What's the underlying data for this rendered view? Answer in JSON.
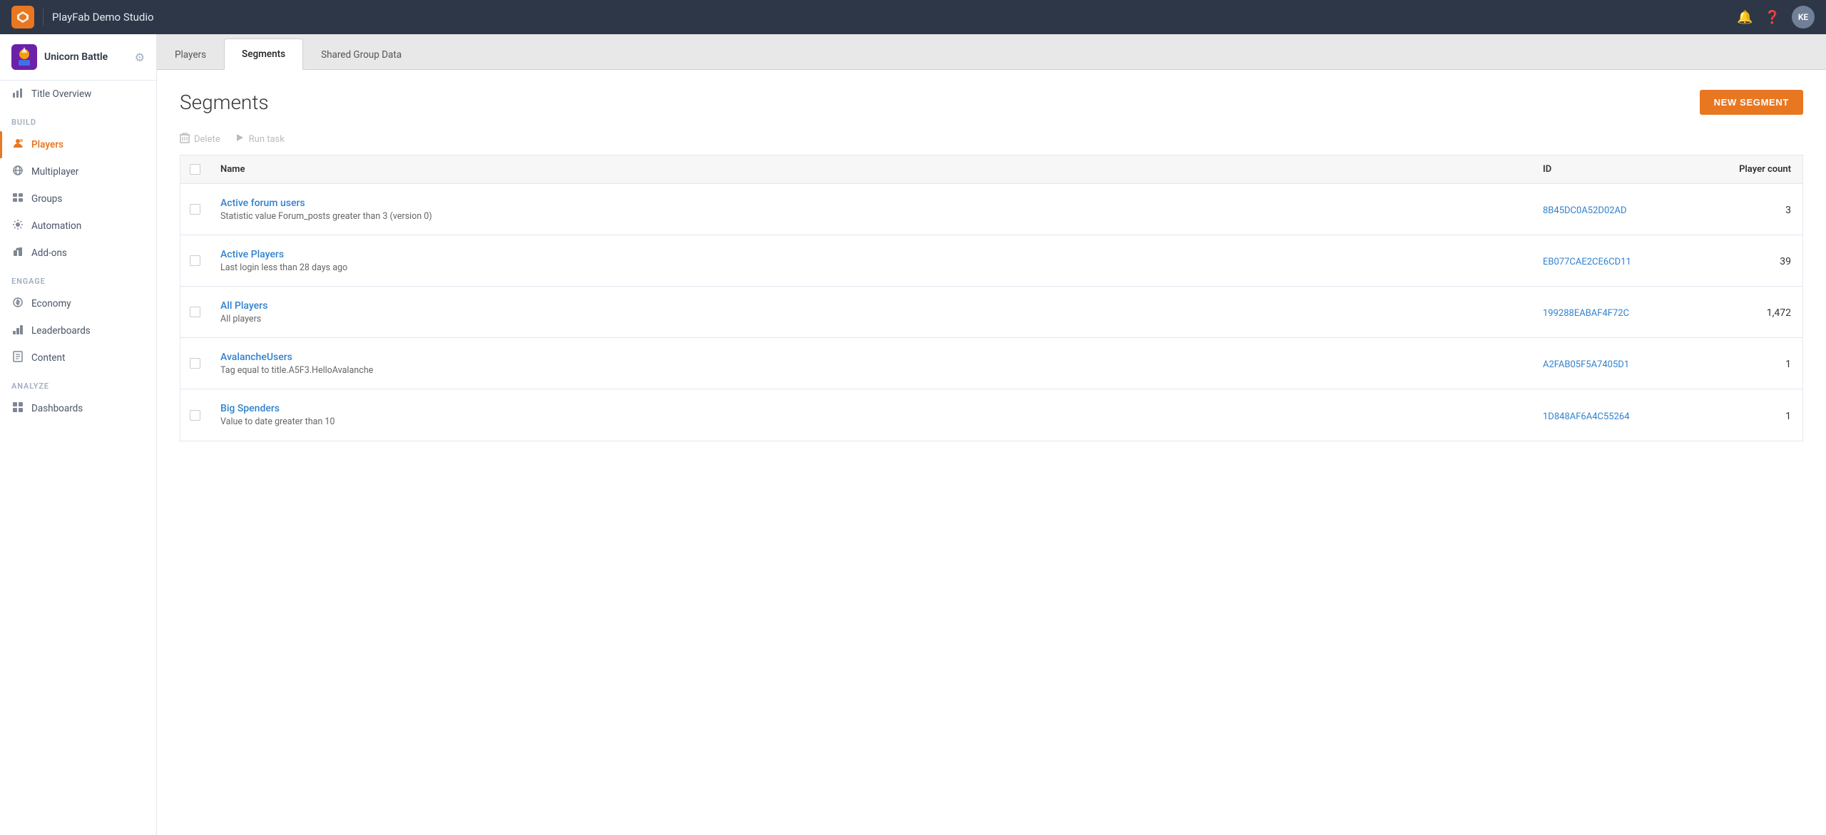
{
  "app": {
    "studio_name": "PlayFab Demo Studio",
    "avatar_initials": "KE",
    "logo_icon": "🔶"
  },
  "sidebar": {
    "game_name": "Unicorn Battle",
    "sections": [
      {
        "label": "",
        "items": [
          {
            "id": "title-overview",
            "label": "Title Overview",
            "icon": "📊",
            "active": false
          }
        ]
      },
      {
        "label": "BUILD",
        "items": [
          {
            "id": "players",
            "label": "Players",
            "icon": "👤",
            "active": true
          },
          {
            "id": "multiplayer",
            "label": "Multiplayer",
            "icon": "🌐",
            "active": false
          },
          {
            "id": "groups",
            "label": "Groups",
            "icon": "🗂",
            "active": false
          },
          {
            "id": "automation",
            "label": "Automation",
            "icon": "🤖",
            "active": false
          },
          {
            "id": "add-ons",
            "label": "Add-ons",
            "icon": "🔌",
            "active": false
          }
        ]
      },
      {
        "label": "ENGAGE",
        "items": [
          {
            "id": "economy",
            "label": "Economy",
            "icon": "💰",
            "active": false
          },
          {
            "id": "leaderboards",
            "label": "Leaderboards",
            "icon": "🏆",
            "active": false
          },
          {
            "id": "content",
            "label": "Content",
            "icon": "📄",
            "active": false
          }
        ]
      },
      {
        "label": "ANALYZE",
        "items": [
          {
            "id": "dashboards",
            "label": "Dashboards",
            "icon": "📈",
            "active": false
          }
        ]
      }
    ]
  },
  "tabs": [
    {
      "id": "players",
      "label": "Players",
      "active": false
    },
    {
      "id": "segments",
      "label": "Segments",
      "active": true
    },
    {
      "id": "shared-group-data",
      "label": "Shared Group Data",
      "active": false
    }
  ],
  "page": {
    "title": "Segments",
    "new_segment_label": "NEW SEGMENT"
  },
  "toolbar": {
    "delete_label": "Delete",
    "run_task_label": "Run task"
  },
  "table": {
    "columns": [
      {
        "id": "name",
        "label": "Name"
      },
      {
        "id": "id",
        "label": "ID"
      },
      {
        "id": "player_count",
        "label": "Player count"
      }
    ],
    "rows": [
      {
        "id": 1,
        "name": "Active forum users",
        "description": "Statistic value Forum_posts greater than 3 (version 0)",
        "segment_id": "8B45DC0A52D02AD",
        "player_count": "3"
      },
      {
        "id": 2,
        "name": "Active Players",
        "description": "Last login less than 28 days ago",
        "segment_id": "EB077CAE2CE6CD11",
        "player_count": "39"
      },
      {
        "id": 3,
        "name": "All Players",
        "description": "All players",
        "segment_id": "199288EABAF4F72C",
        "player_count": "1,472"
      },
      {
        "id": 4,
        "name": "AvalancheUsers",
        "description": "Tag equal to title.A5F3.HelloAvalanche",
        "segment_id": "A2FAB05F5A7405D1",
        "player_count": "1"
      },
      {
        "id": 5,
        "name": "Big Spenders",
        "description": "Value to date greater than 10",
        "segment_id": "1D848AF6A4C55264",
        "player_count": "1"
      }
    ]
  }
}
